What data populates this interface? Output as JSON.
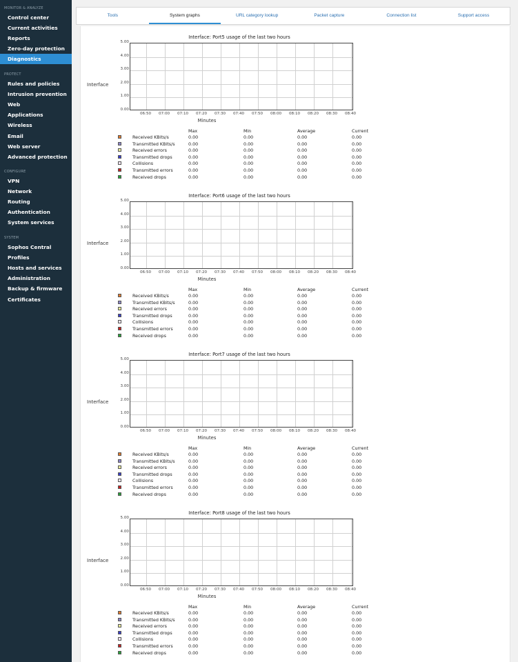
{
  "sidebar": {
    "sections": [
      {
        "header": "MONITOR & ANALYZE",
        "items": [
          "Control center",
          "Current activities",
          "Reports",
          "Zero-day protection",
          "Diagnostics"
        ]
      },
      {
        "header": "PROTECT",
        "items": [
          "Rules and policies",
          "Intrusion prevention",
          "Web",
          "Applications",
          "Wireless",
          "Email",
          "Web server",
          "Advanced protection"
        ]
      },
      {
        "header": "CONFIGURE",
        "items": [
          "VPN",
          "Network",
          "Routing",
          "Authentication",
          "System services"
        ]
      },
      {
        "header": "SYSTEM",
        "items": [
          "Sophos Central",
          "Profiles",
          "Hosts and services",
          "Administration",
          "Backup & firmware",
          "Certificates"
        ]
      }
    ],
    "active_item": "Diagnostics"
  },
  "tabs": [
    "Tools",
    "System graphs",
    "URL category lookup",
    "Packet capture",
    "Connection list",
    "Support access"
  ],
  "active_tab": "System graphs",
  "graphs": [
    {
      "title": "Interface: Port5 usage of the last two hours"
    },
    {
      "title": "Interface: Port6 usage of the last two hours"
    },
    {
      "title": "Interface: Port7 usage of the last two hours"
    },
    {
      "title": "Interface: Port8 usage of the last two hours"
    }
  ],
  "y_axis_label": "Interface",
  "x_axis_label": "Minutes",
  "y_ticks": [
    "5.00",
    "4.00",
    "3.00",
    "2.00",
    "1.00",
    "0.00"
  ],
  "x_ticks": [
    "06:50",
    "07:00",
    "07:10",
    "07:20",
    "07:30",
    "07:40",
    "07:50",
    "08:00",
    "08:10",
    "08:20",
    "08:30",
    "08:40"
  ],
  "stats_columns": [
    "Max",
    "Min",
    "Average",
    "Current"
  ],
  "metrics": [
    {
      "label": "Received KBits/s",
      "color": "#e07b2e",
      "values": [
        "0.00",
        "0.00",
        "0.00",
        "0.00"
      ]
    },
    {
      "label": "Transmitted KBits/s",
      "color": "#8c86c8",
      "values": [
        "0.00",
        "0.00",
        "0.00",
        "0.00"
      ]
    },
    {
      "label": "Received errors",
      "color": "#e8ea9a",
      "values": [
        "0.00",
        "0.00",
        "0.00",
        "0.00"
      ]
    },
    {
      "label": "Transmitted drops",
      "color": "#3a3fc9",
      "values": [
        "0.00",
        "0.00",
        "0.00",
        "0.00"
      ]
    },
    {
      "label": "Collisions",
      "color": "#f2e6f2",
      "values": [
        "0.00",
        "0.00",
        "0.00",
        "0.00"
      ]
    },
    {
      "label": "Transmitted errors",
      "color": "#c82323",
      "values": [
        "0.00",
        "0.00",
        "0.00",
        "0.00"
      ]
    },
    {
      "label": "Received drops",
      "color": "#2aa33a",
      "values": [
        "0.00",
        "0.00",
        "0.00",
        "0.00"
      ]
    }
  ],
  "chart_data": [
    {
      "type": "line",
      "title": "Interface: Port5 usage of the last two hours",
      "xlabel": "Minutes",
      "ylabel": "Interface",
      "ylim": [
        0,
        5
      ],
      "x": [
        "06:50",
        "07:00",
        "07:10",
        "07:20",
        "07:30",
        "07:40",
        "07:50",
        "08:00",
        "08:10",
        "08:20",
        "08:30",
        "08:40"
      ],
      "series": [],
      "grid": true
    },
    {
      "type": "line",
      "title": "Interface: Port6 usage of the last two hours",
      "xlabel": "Minutes",
      "ylabel": "Interface",
      "ylim": [
        0,
        5
      ],
      "x": [
        "06:50",
        "07:00",
        "07:10",
        "07:20",
        "07:30",
        "07:40",
        "07:50",
        "08:00",
        "08:10",
        "08:20",
        "08:30",
        "08:40"
      ],
      "series": [],
      "grid": true
    },
    {
      "type": "line",
      "title": "Interface: Port7 usage of the last two hours",
      "xlabel": "Minutes",
      "ylabel": "Interface",
      "ylim": [
        0,
        5
      ],
      "x": [
        "06:50",
        "07:00",
        "07:10",
        "07:20",
        "07:30",
        "07:40",
        "07:50",
        "08:00",
        "08:10",
        "08:20",
        "08:30",
        "08:40"
      ],
      "series": [],
      "grid": true
    },
    {
      "type": "line",
      "title": "Interface: Port8 usage of the last two hours",
      "xlabel": "Minutes",
      "ylabel": "Interface",
      "ylim": [
        0,
        5
      ],
      "x": [
        "06:50",
        "07:00",
        "07:10",
        "07:20",
        "07:30",
        "07:40",
        "07:50",
        "08:00",
        "08:10",
        "08:20",
        "08:30",
        "08:40"
      ],
      "series": [],
      "grid": true
    }
  ]
}
